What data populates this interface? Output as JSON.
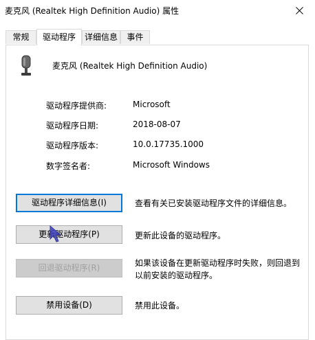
{
  "window": {
    "title": "麦克风 (Realtek High Definition Audio) 属性"
  },
  "tabs": [
    {
      "label": "常规"
    },
    {
      "label": "驱动程序"
    },
    {
      "label": "详细信息"
    },
    {
      "label": "事件"
    }
  ],
  "device": {
    "name": "麦克风 (Realtek High Definition Audio)"
  },
  "info": [
    {
      "label": "驱动程序提供商:",
      "value": "Microsoft"
    },
    {
      "label": "驱动程序日期:",
      "value": "2018-08-07"
    },
    {
      "label": "驱动程序版本:",
      "value": "10.0.17735.1000"
    },
    {
      "label": "数字签名者:",
      "value": "Microsoft Windows"
    }
  ],
  "actions": [
    {
      "button": "驱动程序详细信息(I)",
      "desc": "查看有关已安装驱动程序文件的详细信息。"
    },
    {
      "button": "更新驱动程序(P)",
      "desc": "更新此设备的驱动程序。"
    },
    {
      "button": "回退驱动程序(R)",
      "desc_line1": "如果该设备在更新驱动程序时失败，则回退到",
      "desc_line2": "以前安装的驱动程序。"
    },
    {
      "button": "禁用设备(D)",
      "desc": "禁用此设备。"
    }
  ],
  "colors": {
    "accent": "#0078d7",
    "button_bg": "#e1e1e1",
    "disabled_text": "#a0a0a0"
  }
}
